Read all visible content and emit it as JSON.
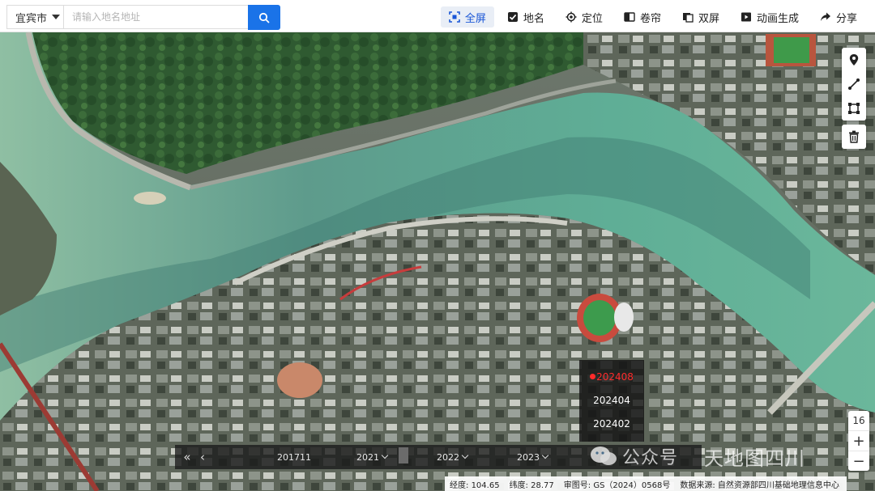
{
  "toolbar": {
    "city": "宜宾市",
    "search_placeholder": "请输入地名地址",
    "tools": [
      {
        "label": "全屏",
        "icon": "fullscreen-icon",
        "active": true
      },
      {
        "label": "地名",
        "icon": "checkbox-checked-icon",
        "active": false
      },
      {
        "label": "定位",
        "icon": "locate-icon",
        "active": false
      },
      {
        "label": "卷帘",
        "icon": "swipe-icon",
        "active": false
      },
      {
        "label": "双屏",
        "icon": "dual-screen-icon",
        "active": false
      },
      {
        "label": "动画生成",
        "icon": "animation-icon",
        "active": false
      },
      {
        "label": "分享",
        "icon": "share-icon",
        "active": false
      }
    ],
    "accent_color": "#1a73e8"
  },
  "map_tools": {
    "items": [
      "marker-icon",
      "line-icon",
      "polygon-icon"
    ],
    "delete": "trash-icon"
  },
  "zoom": {
    "level": "16",
    "in_label": "+",
    "out_label": "−"
  },
  "date_popup": {
    "items": [
      "202408",
      "202404",
      "202402"
    ],
    "selected_index": 0,
    "selected_color": "#ff2b2b"
  },
  "timeline": {
    "first_label": "201711",
    "years": [
      "2021",
      "2022",
      "2023"
    ]
  },
  "watermark": {
    "text": "公众号",
    "brand": "天地图四川"
  },
  "status": {
    "lng_label": "经度:",
    "lng": "104.65",
    "lat_label": "纬度:",
    "lat": "28.77",
    "review_label": "审图号:",
    "review": "GS（2024）0568号",
    "source_label": "数据来源:",
    "source": "自然资源部四川基础地理信息中心"
  }
}
